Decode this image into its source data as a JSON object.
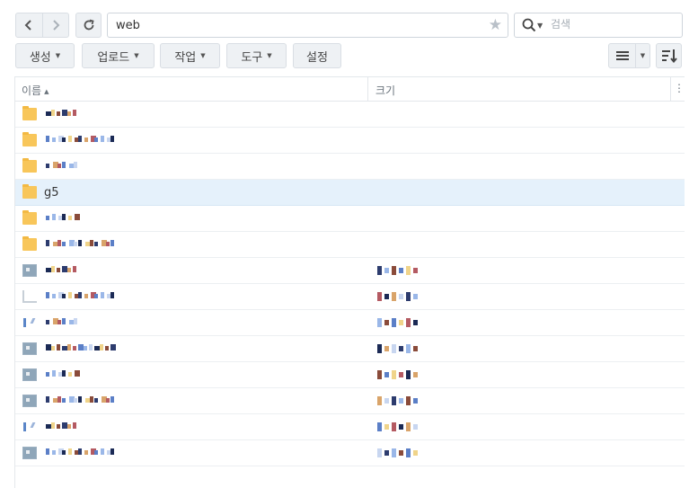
{
  "toolbar": {
    "back_icon": "chevron-left-icon",
    "forward_icon": "chevron-right-icon",
    "refresh_icon": "refresh-icon",
    "path": "web",
    "bookmark_icon": "star-icon",
    "search_placeholder": "검색"
  },
  "actions": {
    "create": "생성",
    "upload": "업로드",
    "action": "작업",
    "tools": "도구",
    "settings": "설정"
  },
  "columns": {
    "name": "이름",
    "size": "크기",
    "menu": "⋮"
  },
  "rows": [
    {
      "type": "folder",
      "name": "",
      "size": ""
    },
    {
      "type": "folder",
      "name": "",
      "size": ""
    },
    {
      "type": "folder",
      "name": "",
      "size": ""
    },
    {
      "type": "folder",
      "name": "g5",
      "size": "",
      "selected": true
    },
    {
      "type": "folder",
      "name": "",
      "size": ""
    },
    {
      "type": "folder",
      "name": "",
      "size": ""
    },
    {
      "type": "file",
      "name": "",
      "size": ""
    },
    {
      "type": "doc",
      "name": "",
      "size": ""
    },
    {
      "type": "image",
      "name": "",
      "size": ""
    },
    {
      "type": "file",
      "name": "",
      "size": ""
    },
    {
      "type": "file",
      "name": "",
      "size": ""
    },
    {
      "type": "file",
      "name": "",
      "size": ""
    },
    {
      "type": "image",
      "name": "",
      "size": ""
    },
    {
      "type": "file",
      "name": "",
      "size": ""
    }
  ]
}
